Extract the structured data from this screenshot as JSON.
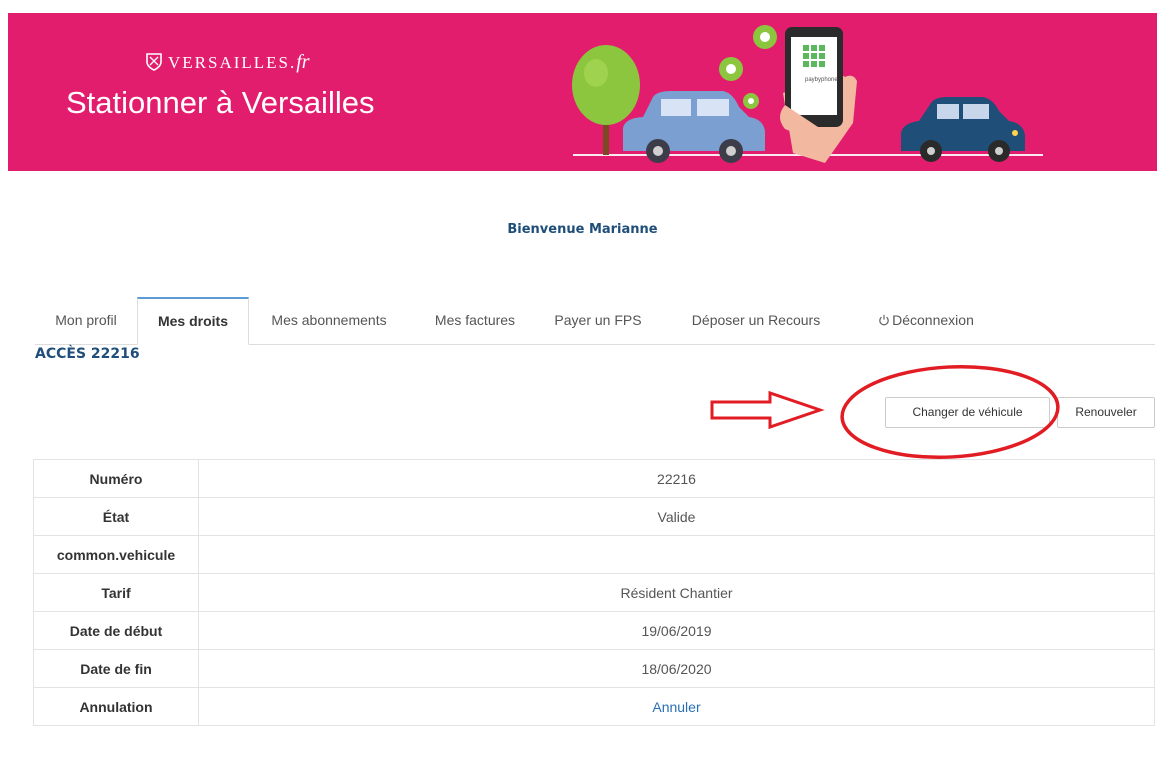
{
  "header": {
    "brand_name": "VERSAILLES.",
    "brand_suffix": "fr",
    "site_title": "Stationner à Versailles",
    "phone_label": "paybyphone"
  },
  "welcome": "Bienvenue Marianne",
  "tabs": [
    {
      "label": "Mon profil"
    },
    {
      "label": "Mes droits",
      "active": true
    },
    {
      "label": "Mes abonnements"
    },
    {
      "label": "Mes factures"
    },
    {
      "label": "Payer un FPS"
    },
    {
      "label": "Déposer un Recours"
    },
    {
      "label": "Déconnexion",
      "icon": "power-icon"
    }
  ],
  "access_title": "ACCÈS 22216",
  "actions": {
    "change_vehicle": "Changer de véhicule",
    "renew": "Renouveler"
  },
  "details": [
    {
      "label": "Numéro",
      "value": "22216"
    },
    {
      "label": "État",
      "value": "Valide"
    },
    {
      "label": "common.vehicule",
      "value": ""
    },
    {
      "label": "Tarif",
      "value": "Résident Chantier"
    },
    {
      "label": "Date de début",
      "value": "19/06/2019"
    },
    {
      "label": "Date de fin",
      "value": "18/06/2020"
    },
    {
      "label": "Annulation",
      "value": "Annuler",
      "link": true
    }
  ],
  "colors": {
    "banner": "#e31d6d",
    "link": "#2a6fb6",
    "heading": "#1e4e79",
    "annotation": "#e21c23"
  }
}
